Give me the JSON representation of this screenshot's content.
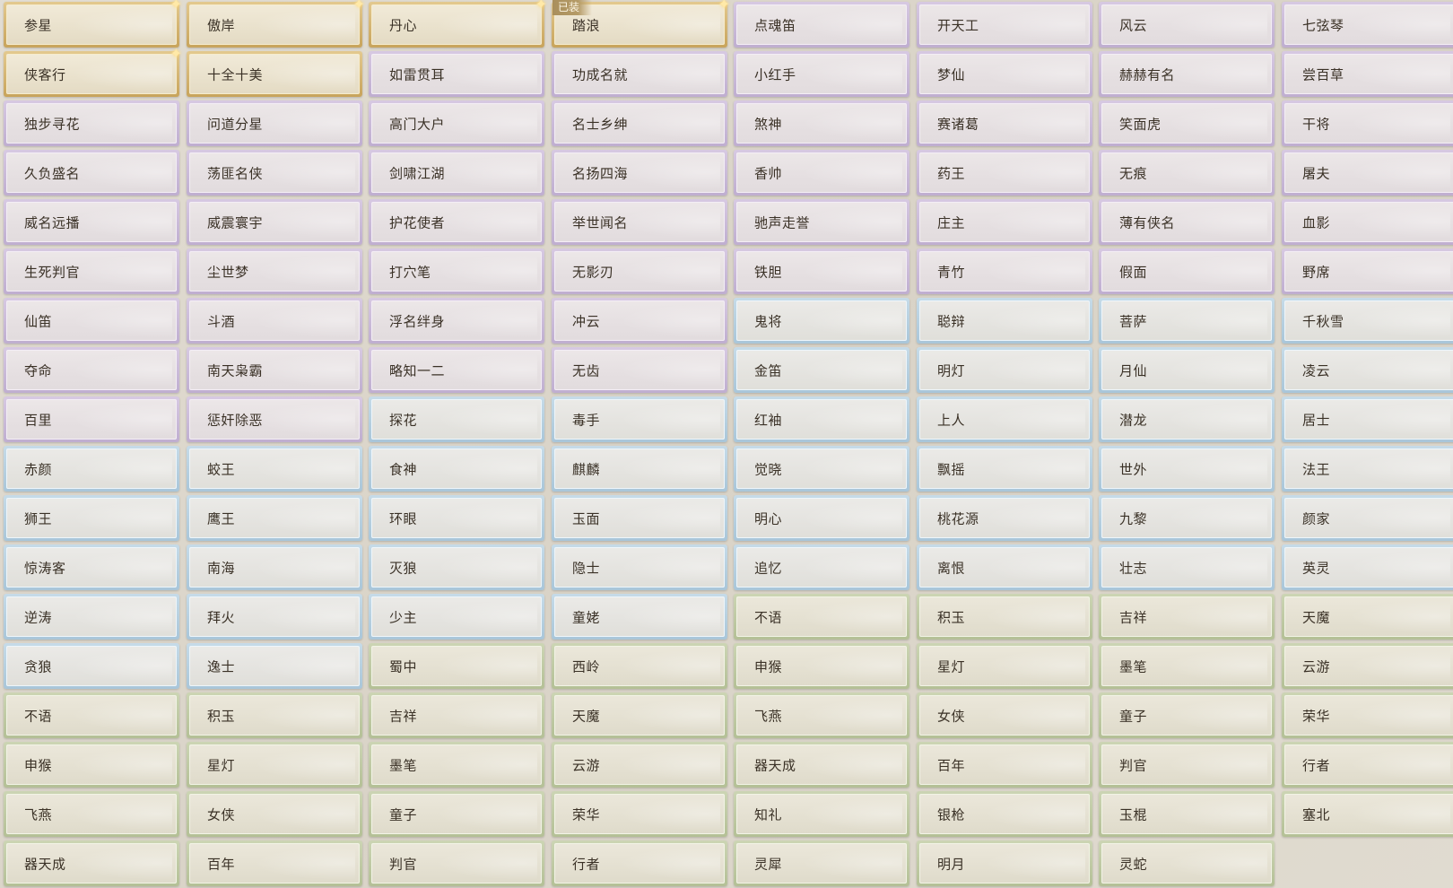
{
  "equipped_badge": "已装",
  "tier_colors": {
    "gold": "#c8a45c",
    "purple": "#bfaed0",
    "blue": "#a9c6d9",
    "green": "#b4c096"
  },
  "titles": [
    {
      "label": "参星",
      "tier": "gold",
      "sparkle": true
    },
    {
      "label": "傲岸",
      "tier": "gold",
      "sparkle": true
    },
    {
      "label": "丹心",
      "tier": "gold",
      "sparkle": true
    },
    {
      "label": "踏浪",
      "tier": "gold",
      "sparkle": true,
      "equipped": true
    },
    {
      "label": "点魂笛",
      "tier": "purple"
    },
    {
      "label": "开天工",
      "tier": "purple"
    },
    {
      "label": "风云",
      "tier": "purple"
    },
    {
      "label": "七弦琴",
      "tier": "purple"
    },
    {
      "label": "侠客行",
      "tier": "gold",
      "sparkle": true
    },
    {
      "label": "十全十美",
      "tier": "gold"
    },
    {
      "label": "如雷贯耳",
      "tier": "purple"
    },
    {
      "label": "功成名就",
      "tier": "purple"
    },
    {
      "label": "小红手",
      "tier": "purple"
    },
    {
      "label": "梦仙",
      "tier": "purple"
    },
    {
      "label": "赫赫有名",
      "tier": "purple"
    },
    {
      "label": "尝百草",
      "tier": "purple"
    },
    {
      "label": "独步寻花",
      "tier": "purple"
    },
    {
      "label": "问道分星",
      "tier": "purple"
    },
    {
      "label": "高门大户",
      "tier": "purple"
    },
    {
      "label": "名士乡绅",
      "tier": "purple"
    },
    {
      "label": "煞神",
      "tier": "purple"
    },
    {
      "label": "赛诸葛",
      "tier": "purple"
    },
    {
      "label": "笑面虎",
      "tier": "purple"
    },
    {
      "label": "干将",
      "tier": "purple"
    },
    {
      "label": "久负盛名",
      "tier": "purple"
    },
    {
      "label": "荡匪名侠",
      "tier": "purple"
    },
    {
      "label": "剑啸江湖",
      "tier": "purple"
    },
    {
      "label": "名扬四海",
      "tier": "purple"
    },
    {
      "label": "香帅",
      "tier": "purple"
    },
    {
      "label": "药王",
      "tier": "purple"
    },
    {
      "label": "无痕",
      "tier": "purple"
    },
    {
      "label": "屠夫",
      "tier": "purple"
    },
    {
      "label": "威名远播",
      "tier": "purple"
    },
    {
      "label": "威震寰宇",
      "tier": "purple"
    },
    {
      "label": "护花使者",
      "tier": "purple"
    },
    {
      "label": "举世闻名",
      "tier": "purple"
    },
    {
      "label": "驰声走誉",
      "tier": "purple"
    },
    {
      "label": "庄主",
      "tier": "purple"
    },
    {
      "label": "薄有侠名",
      "tier": "purple"
    },
    {
      "label": "血影",
      "tier": "purple"
    },
    {
      "label": "生死判官",
      "tier": "purple"
    },
    {
      "label": "尘世梦",
      "tier": "purple"
    },
    {
      "label": "打穴笔",
      "tier": "purple"
    },
    {
      "label": "无影刃",
      "tier": "purple"
    },
    {
      "label": "铁胆",
      "tier": "purple"
    },
    {
      "label": "青竹",
      "tier": "purple"
    },
    {
      "label": "假面",
      "tier": "purple"
    },
    {
      "label": "野席",
      "tier": "purple"
    },
    {
      "label": "仙笛",
      "tier": "purple"
    },
    {
      "label": "斗酒",
      "tier": "purple"
    },
    {
      "label": "浮名绊身",
      "tier": "purple"
    },
    {
      "label": "冲云",
      "tier": "purple"
    },
    {
      "label": "鬼将",
      "tier": "blue"
    },
    {
      "label": "聪辩",
      "tier": "blue"
    },
    {
      "label": "菩萨",
      "tier": "blue"
    },
    {
      "label": "千秋雪",
      "tier": "blue"
    },
    {
      "label": "夺命",
      "tier": "purple"
    },
    {
      "label": "南天枭霸",
      "tier": "purple"
    },
    {
      "label": "略知一二",
      "tier": "purple"
    },
    {
      "label": "无齿",
      "tier": "purple"
    },
    {
      "label": "金笛",
      "tier": "blue"
    },
    {
      "label": "明灯",
      "tier": "blue"
    },
    {
      "label": "月仙",
      "tier": "blue"
    },
    {
      "label": "凌云",
      "tier": "blue"
    },
    {
      "label": "百里",
      "tier": "purple"
    },
    {
      "label": "惩奸除恶",
      "tier": "purple"
    },
    {
      "label": "探花",
      "tier": "blue"
    },
    {
      "label": "毒手",
      "tier": "blue"
    },
    {
      "label": "红袖",
      "tier": "blue"
    },
    {
      "label": "上人",
      "tier": "blue"
    },
    {
      "label": "潜龙",
      "tier": "blue"
    },
    {
      "label": "居士",
      "tier": "blue"
    },
    {
      "label": "赤颜",
      "tier": "blue"
    },
    {
      "label": "蛟王",
      "tier": "blue"
    },
    {
      "label": "食神",
      "tier": "blue"
    },
    {
      "label": "麒麟",
      "tier": "blue"
    },
    {
      "label": "觉晓",
      "tier": "blue"
    },
    {
      "label": "飘摇",
      "tier": "blue"
    },
    {
      "label": "世外",
      "tier": "blue"
    },
    {
      "label": "法王",
      "tier": "blue"
    },
    {
      "label": "狮王",
      "tier": "blue"
    },
    {
      "label": "鹰王",
      "tier": "blue"
    },
    {
      "label": "环眼",
      "tier": "blue"
    },
    {
      "label": "玉面",
      "tier": "blue"
    },
    {
      "label": "明心",
      "tier": "blue"
    },
    {
      "label": "桃花源",
      "tier": "blue"
    },
    {
      "label": "九黎",
      "tier": "blue"
    },
    {
      "label": "颜家",
      "tier": "blue"
    },
    {
      "label": "惊涛客",
      "tier": "blue"
    },
    {
      "label": "南海",
      "tier": "blue"
    },
    {
      "label": "灭狼",
      "tier": "blue"
    },
    {
      "label": "隐士",
      "tier": "blue"
    },
    {
      "label": "追忆",
      "tier": "blue"
    },
    {
      "label": "离恨",
      "tier": "blue"
    },
    {
      "label": "壮志",
      "tier": "blue"
    },
    {
      "label": "英灵",
      "tier": "blue"
    },
    {
      "label": "逆涛",
      "tier": "blue"
    },
    {
      "label": "拜火",
      "tier": "blue"
    },
    {
      "label": "少主",
      "tier": "blue"
    },
    {
      "label": "童姥",
      "tier": "blue"
    },
    {
      "label": "不语",
      "tier": "green"
    },
    {
      "label": "积玉",
      "tier": "green"
    },
    {
      "label": "吉祥",
      "tier": "green"
    },
    {
      "label": "天魔",
      "tier": "green"
    },
    {
      "label": "贪狼",
      "tier": "blue"
    },
    {
      "label": "逸士",
      "tier": "blue"
    },
    {
      "label": "蜀中",
      "tier": "green"
    },
    {
      "label": "西岭",
      "tier": "green"
    },
    {
      "label": "申猴",
      "tier": "green"
    },
    {
      "label": "星灯",
      "tier": "green"
    },
    {
      "label": "墨笔",
      "tier": "green"
    },
    {
      "label": "云游",
      "tier": "green"
    },
    {
      "label": "不语",
      "tier": "green"
    },
    {
      "label": "积玉",
      "tier": "green"
    },
    {
      "label": "吉祥",
      "tier": "green"
    },
    {
      "label": "天魔",
      "tier": "green"
    },
    {
      "label": "飞燕",
      "tier": "green"
    },
    {
      "label": "女侠",
      "tier": "green"
    },
    {
      "label": "童子",
      "tier": "green"
    },
    {
      "label": "荣华",
      "tier": "green"
    },
    {
      "label": "申猴",
      "tier": "green"
    },
    {
      "label": "星灯",
      "tier": "green"
    },
    {
      "label": "墨笔",
      "tier": "green"
    },
    {
      "label": "云游",
      "tier": "green"
    },
    {
      "label": "器天成",
      "tier": "green"
    },
    {
      "label": "百年",
      "tier": "green"
    },
    {
      "label": "判官",
      "tier": "green"
    },
    {
      "label": "行者",
      "tier": "green"
    },
    {
      "label": "飞燕",
      "tier": "green"
    },
    {
      "label": "女侠",
      "tier": "green"
    },
    {
      "label": "童子",
      "tier": "green"
    },
    {
      "label": "荣华",
      "tier": "green"
    },
    {
      "label": "知礼",
      "tier": "green"
    },
    {
      "label": "银枪",
      "tier": "green"
    },
    {
      "label": "玉棍",
      "tier": "green"
    },
    {
      "label": "塞北",
      "tier": "green"
    },
    {
      "label": "器天成",
      "tier": "green"
    },
    {
      "label": "百年",
      "tier": "green"
    },
    {
      "label": "判官",
      "tier": "green"
    },
    {
      "label": "行者",
      "tier": "green"
    },
    {
      "label": "灵犀",
      "tier": "green"
    },
    {
      "label": "明月",
      "tier": "green"
    },
    {
      "label": "灵蛇",
      "tier": "green"
    }
  ]
}
